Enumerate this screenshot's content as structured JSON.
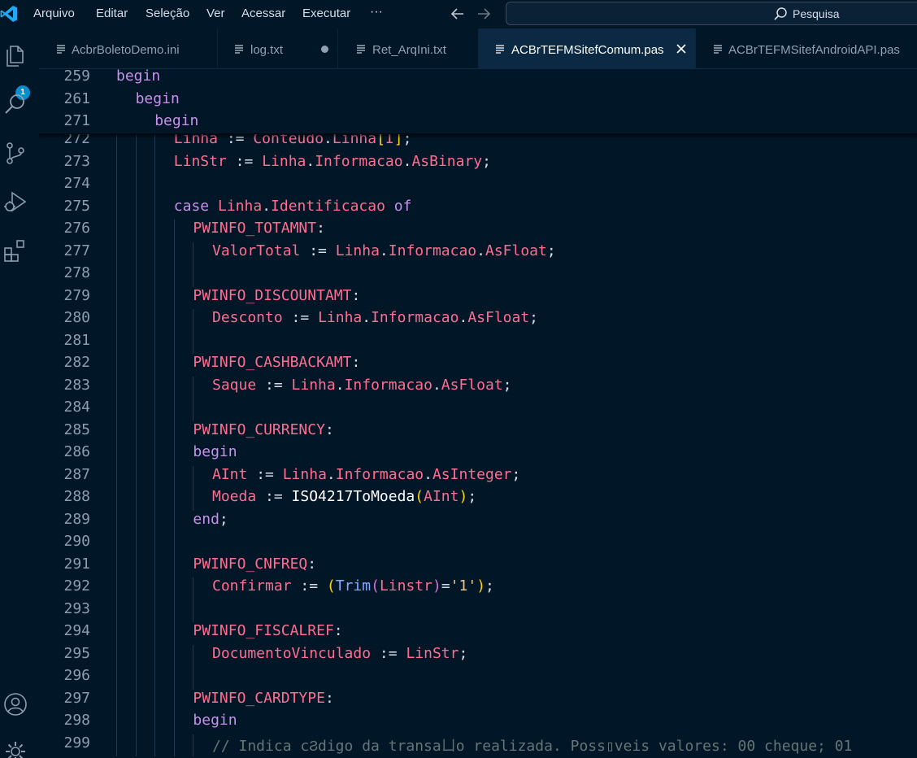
{
  "menu": [
    "Arquivo",
    "Editar",
    "Seleção",
    "Ver",
    "Acessar",
    "Executar",
    "···"
  ],
  "search": {
    "label": "Pesquisa"
  },
  "activity": {
    "explorer_badge": "1"
  },
  "tabs": [
    {
      "label": "AcbrBoletoDemo.ini",
      "active": false,
      "dirty": false
    },
    {
      "label": "log.txt",
      "active": false,
      "dirty": true
    },
    {
      "label": "Ret_ArqIni.txt",
      "active": false,
      "dirty": false
    },
    {
      "label": "ACBrTEFMSitefComum.pas",
      "active": true,
      "dirty": false
    },
    {
      "label": "ACBrTEFMSitefAndroidAPI.pas",
      "active": false,
      "dirty": false
    }
  ],
  "colors": {
    "background": "#011627",
    "keyword": "#c792ea",
    "identifier": "#ff6e8f",
    "function": "#82aaff",
    "string": "#ecc48d",
    "comment": "#637777",
    "badge": "#0b8ccf"
  },
  "sticky_lines": [
    {
      "num": "259",
      "indent": 0,
      "tokens": [
        [
          "begin",
          "kw"
        ]
      ]
    },
    {
      "num": "261",
      "indent": 1,
      "tokens": [
        [
          "begin",
          "kw"
        ]
      ]
    },
    {
      "num": "271",
      "indent": 2,
      "tokens": [
        [
          "begin",
          "kw"
        ]
      ]
    }
  ],
  "code_lines": [
    {
      "num": "272",
      "indent": 3,
      "tokens": [
        [
          "Linha",
          "id"
        ],
        [
          " := ",
          "tx"
        ],
        [
          "Conteudo",
          "id"
        ],
        [
          ".",
          "tx"
        ],
        [
          "Linha",
          "id"
        ],
        [
          "[",
          "br1"
        ],
        [
          "I",
          "id"
        ],
        [
          "]",
          "br1"
        ],
        [
          ";",
          "tx"
        ]
      ]
    },
    {
      "num": "273",
      "indent": 3,
      "tokens": [
        [
          "LinStr",
          "id"
        ],
        [
          " := ",
          "tx"
        ],
        [
          "Linha",
          "id"
        ],
        [
          ".",
          "tx"
        ],
        [
          "Informacao",
          "id"
        ],
        [
          ".",
          "tx"
        ],
        [
          "AsBinary",
          "id"
        ],
        [
          ";",
          "tx"
        ]
      ]
    },
    {
      "num": "274",
      "indent": 3,
      "tokens": []
    },
    {
      "num": "275",
      "indent": 3,
      "tokens": [
        [
          "case",
          "kw"
        ],
        [
          " ",
          "tx"
        ],
        [
          "Linha",
          "id"
        ],
        [
          ".",
          "tx"
        ],
        [
          "Identificacao",
          "id"
        ],
        [
          " ",
          "tx"
        ],
        [
          "of",
          "kw"
        ]
      ]
    },
    {
      "num": "276",
      "indent": 4,
      "tokens": [
        [
          "PWINFO_TOTAMNT",
          "id"
        ],
        [
          ":",
          "tx"
        ]
      ]
    },
    {
      "num": "277",
      "indent": 5,
      "tokens": [
        [
          "ValorTotal",
          "id"
        ],
        [
          " := ",
          "tx"
        ],
        [
          "Linha",
          "id"
        ],
        [
          ".",
          "tx"
        ],
        [
          "Informacao",
          "id"
        ],
        [
          ".",
          "tx"
        ],
        [
          "AsFloat",
          "id"
        ],
        [
          ";",
          "tx"
        ]
      ]
    },
    {
      "num": "278",
      "indent": 5,
      "tokens": []
    },
    {
      "num": "279",
      "indent": 4,
      "tokens": [
        [
          "PWINFO_DISCOUNTAMT",
          "id"
        ],
        [
          ":",
          "tx"
        ]
      ]
    },
    {
      "num": "280",
      "indent": 5,
      "tokens": [
        [
          "Desconto",
          "id"
        ],
        [
          " := ",
          "tx"
        ],
        [
          "Linha",
          "id"
        ],
        [
          ".",
          "tx"
        ],
        [
          "Informacao",
          "id"
        ],
        [
          ".",
          "tx"
        ],
        [
          "AsFloat",
          "id"
        ],
        [
          ";",
          "tx"
        ]
      ]
    },
    {
      "num": "281",
      "indent": 5,
      "tokens": []
    },
    {
      "num": "282",
      "indent": 4,
      "tokens": [
        [
          "PWINFO_CASHBACKAMT",
          "id"
        ],
        [
          ":",
          "tx"
        ]
      ]
    },
    {
      "num": "283",
      "indent": 5,
      "tokens": [
        [
          "Saque",
          "id"
        ],
        [
          " := ",
          "tx"
        ],
        [
          "Linha",
          "id"
        ],
        [
          ".",
          "tx"
        ],
        [
          "Informacao",
          "id"
        ],
        [
          ".",
          "tx"
        ],
        [
          "AsFloat",
          "id"
        ],
        [
          ";",
          "tx"
        ]
      ]
    },
    {
      "num": "284",
      "indent": 5,
      "tokens": []
    },
    {
      "num": "285",
      "indent": 4,
      "tokens": [
        [
          "PWINFO_CURRENCY",
          "id"
        ],
        [
          ":",
          "tx"
        ]
      ]
    },
    {
      "num": "286",
      "indent": 4,
      "tokens": [
        [
          "begin",
          "kw"
        ]
      ]
    },
    {
      "num": "287",
      "indent": 5,
      "tokens": [
        [
          "AInt",
          "id"
        ],
        [
          " := ",
          "tx"
        ],
        [
          "Linha",
          "id"
        ],
        [
          ".",
          "tx"
        ],
        [
          "Informacao",
          "id"
        ],
        [
          ".",
          "tx"
        ],
        [
          "AsInteger",
          "id"
        ],
        [
          ";",
          "tx"
        ]
      ]
    },
    {
      "num": "288",
      "indent": 5,
      "tokens": [
        [
          "Moeda",
          "id"
        ],
        [
          " := ",
          "tx"
        ],
        [
          "ISO4217ToMoeda",
          "fn2"
        ],
        [
          "(",
          "br1"
        ],
        [
          "AInt",
          "id"
        ],
        [
          ")",
          "br1"
        ],
        [
          ";",
          "tx"
        ]
      ]
    },
    {
      "num": "289",
      "indent": 4,
      "tokens": [
        [
          "end",
          "kw"
        ],
        [
          ";",
          "tx"
        ]
      ]
    },
    {
      "num": "290",
      "indent": 4,
      "tokens": []
    },
    {
      "num": "291",
      "indent": 4,
      "tokens": [
        [
          "PWINFO_CNFREQ",
          "id"
        ],
        [
          ":",
          "tx"
        ]
      ]
    },
    {
      "num": "292",
      "indent": 5,
      "tokens": [
        [
          "Confirmar",
          "id"
        ],
        [
          " := ",
          "tx"
        ],
        [
          "(",
          "br1"
        ],
        [
          "Trim",
          "fn"
        ],
        [
          "(",
          "br2"
        ],
        [
          "Linstr",
          "id"
        ],
        [
          ")",
          "br2"
        ],
        [
          "=",
          "tx"
        ],
        [
          "'1'",
          "st"
        ],
        [
          ")",
          "br1"
        ],
        [
          ";",
          "tx"
        ]
      ]
    },
    {
      "num": "293",
      "indent": 5,
      "tokens": []
    },
    {
      "num": "294",
      "indent": 4,
      "tokens": [
        [
          "PWINFO_FISCALREF",
          "id"
        ],
        [
          ":",
          "tx"
        ]
      ]
    },
    {
      "num": "295",
      "indent": 5,
      "tokens": [
        [
          "DocumentoVinculado",
          "id"
        ],
        [
          " := ",
          "tx"
        ],
        [
          "LinStr",
          "id"
        ],
        [
          ";",
          "tx"
        ]
      ]
    },
    {
      "num": "296",
      "indent": 5,
      "tokens": []
    },
    {
      "num": "297",
      "indent": 4,
      "tokens": [
        [
          "PWINFO_CARDTYPE",
          "id"
        ],
        [
          ":",
          "tx"
        ]
      ]
    },
    {
      "num": "298",
      "indent": 4,
      "tokens": [
        [
          "begin",
          "kw"
        ]
      ]
    },
    {
      "num": "299",
      "indent": 5,
      "tokens": [
        [
          "// Indica cϨdigo da transaㄩo realizada. Poss▯veis valores: 00 cheque; 01",
          "cm"
        ]
      ]
    }
  ]
}
